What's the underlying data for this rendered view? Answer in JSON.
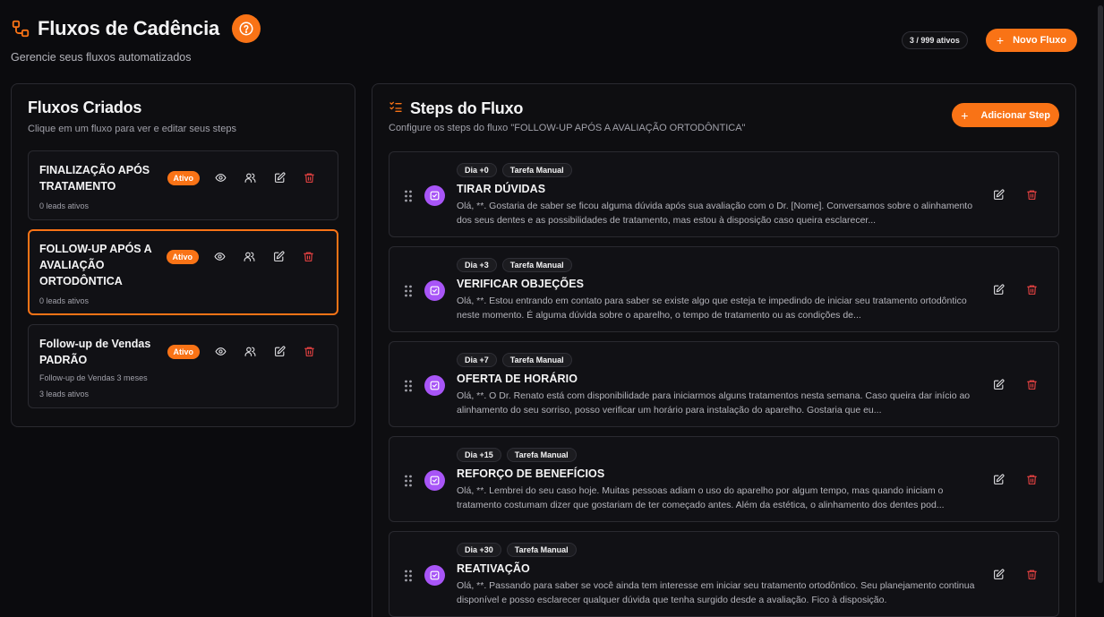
{
  "header": {
    "title": "Fluxos de Cadência",
    "subtitle": "Gerencie seus fluxos automatizados",
    "count": "3 / 999 ativos",
    "new_flow_label": "Novo Fluxo"
  },
  "left": {
    "title": "Fluxos Criados",
    "subtitle": "Clique em um fluxo para ver e editar seus steps",
    "flows": [
      {
        "name": "FINALIZAÇÃO APÓS TRATAMENTO",
        "status": "Ativo",
        "description": "",
        "leads": "0 leads ativos",
        "selected": false
      },
      {
        "name": "FOLLOW-UP APÓS A AVALIAÇÃO ORTODÔNTICA",
        "status": "Ativo",
        "description": "",
        "leads": "0 leads ativos",
        "selected": true
      },
      {
        "name": "Follow-up de Vendas PADRÃO",
        "status": "Ativo",
        "description": "Follow-up de Vendas 3 meses",
        "leads": "3 leads ativos",
        "selected": false
      }
    ]
  },
  "right": {
    "title": "Steps do Fluxo",
    "subtitle": "Configure os steps do fluxo \"FOLLOW-UP APÓS A AVALIAÇÃO ORTODÔNTICA\"",
    "add_step_label": "Adicionar Step",
    "steps": [
      {
        "day": "Dia +0",
        "type": "Tarefa Manual",
        "title": "TIRAR DÚVIDAS",
        "message": "Olá, **. Gostaria de saber se ficou alguma dúvida após sua avaliação com o Dr. [Nome]. Conversamos sobre o alinhamento dos seus dentes e as possibilidades de tratamento, mas estou à disposição caso queira esclarecer..."
      },
      {
        "day": "Dia +3",
        "type": "Tarefa Manual",
        "title": "VERIFICAR OBJEÇÕES",
        "message": "Olá, **. Estou entrando em contato para saber se existe algo que esteja te impedindo de iniciar seu tratamento ortodôntico neste momento. É alguma dúvida sobre o aparelho, o tempo de tratamento ou as condições de..."
      },
      {
        "day": "Dia +7",
        "type": "Tarefa Manual",
        "title": "OFERTA DE HORÁRIO",
        "message": "Olá, **. O Dr. Renato está com disponibilidade para iniciarmos alguns tratamentos nesta semana. Caso queira dar início ao alinhamento do seu sorriso, posso verificar um horário para instalação do aparelho. Gostaria que eu..."
      },
      {
        "day": "Dia +15",
        "type": "Tarefa Manual",
        "title": "REFORÇO DE BENEFÍCIOS",
        "message": "Olá, **. Lembrei do seu caso hoje. Muitas pessoas adiam o uso do aparelho por algum tempo, mas quando iniciam o tratamento costumam dizer que gostariam de ter começado antes. Além da estética, o alinhamento dos dentes pod..."
      },
      {
        "day": "Dia +30",
        "type": "Tarefa Manual",
        "title": "REATIVAÇÃO",
        "message": "Olá, **. Passando para saber se você ainda tem interesse em iniciar seu tratamento ortodôntico. Seu planejamento continua disponível e posso esclarecer qualquer dúvida que tenha surgido desde a avaliação. Fico à disposição."
      }
    ]
  },
  "colors": {
    "accent": "#f97316",
    "step_icon": "#a855f7",
    "delete": "#ef4444"
  }
}
